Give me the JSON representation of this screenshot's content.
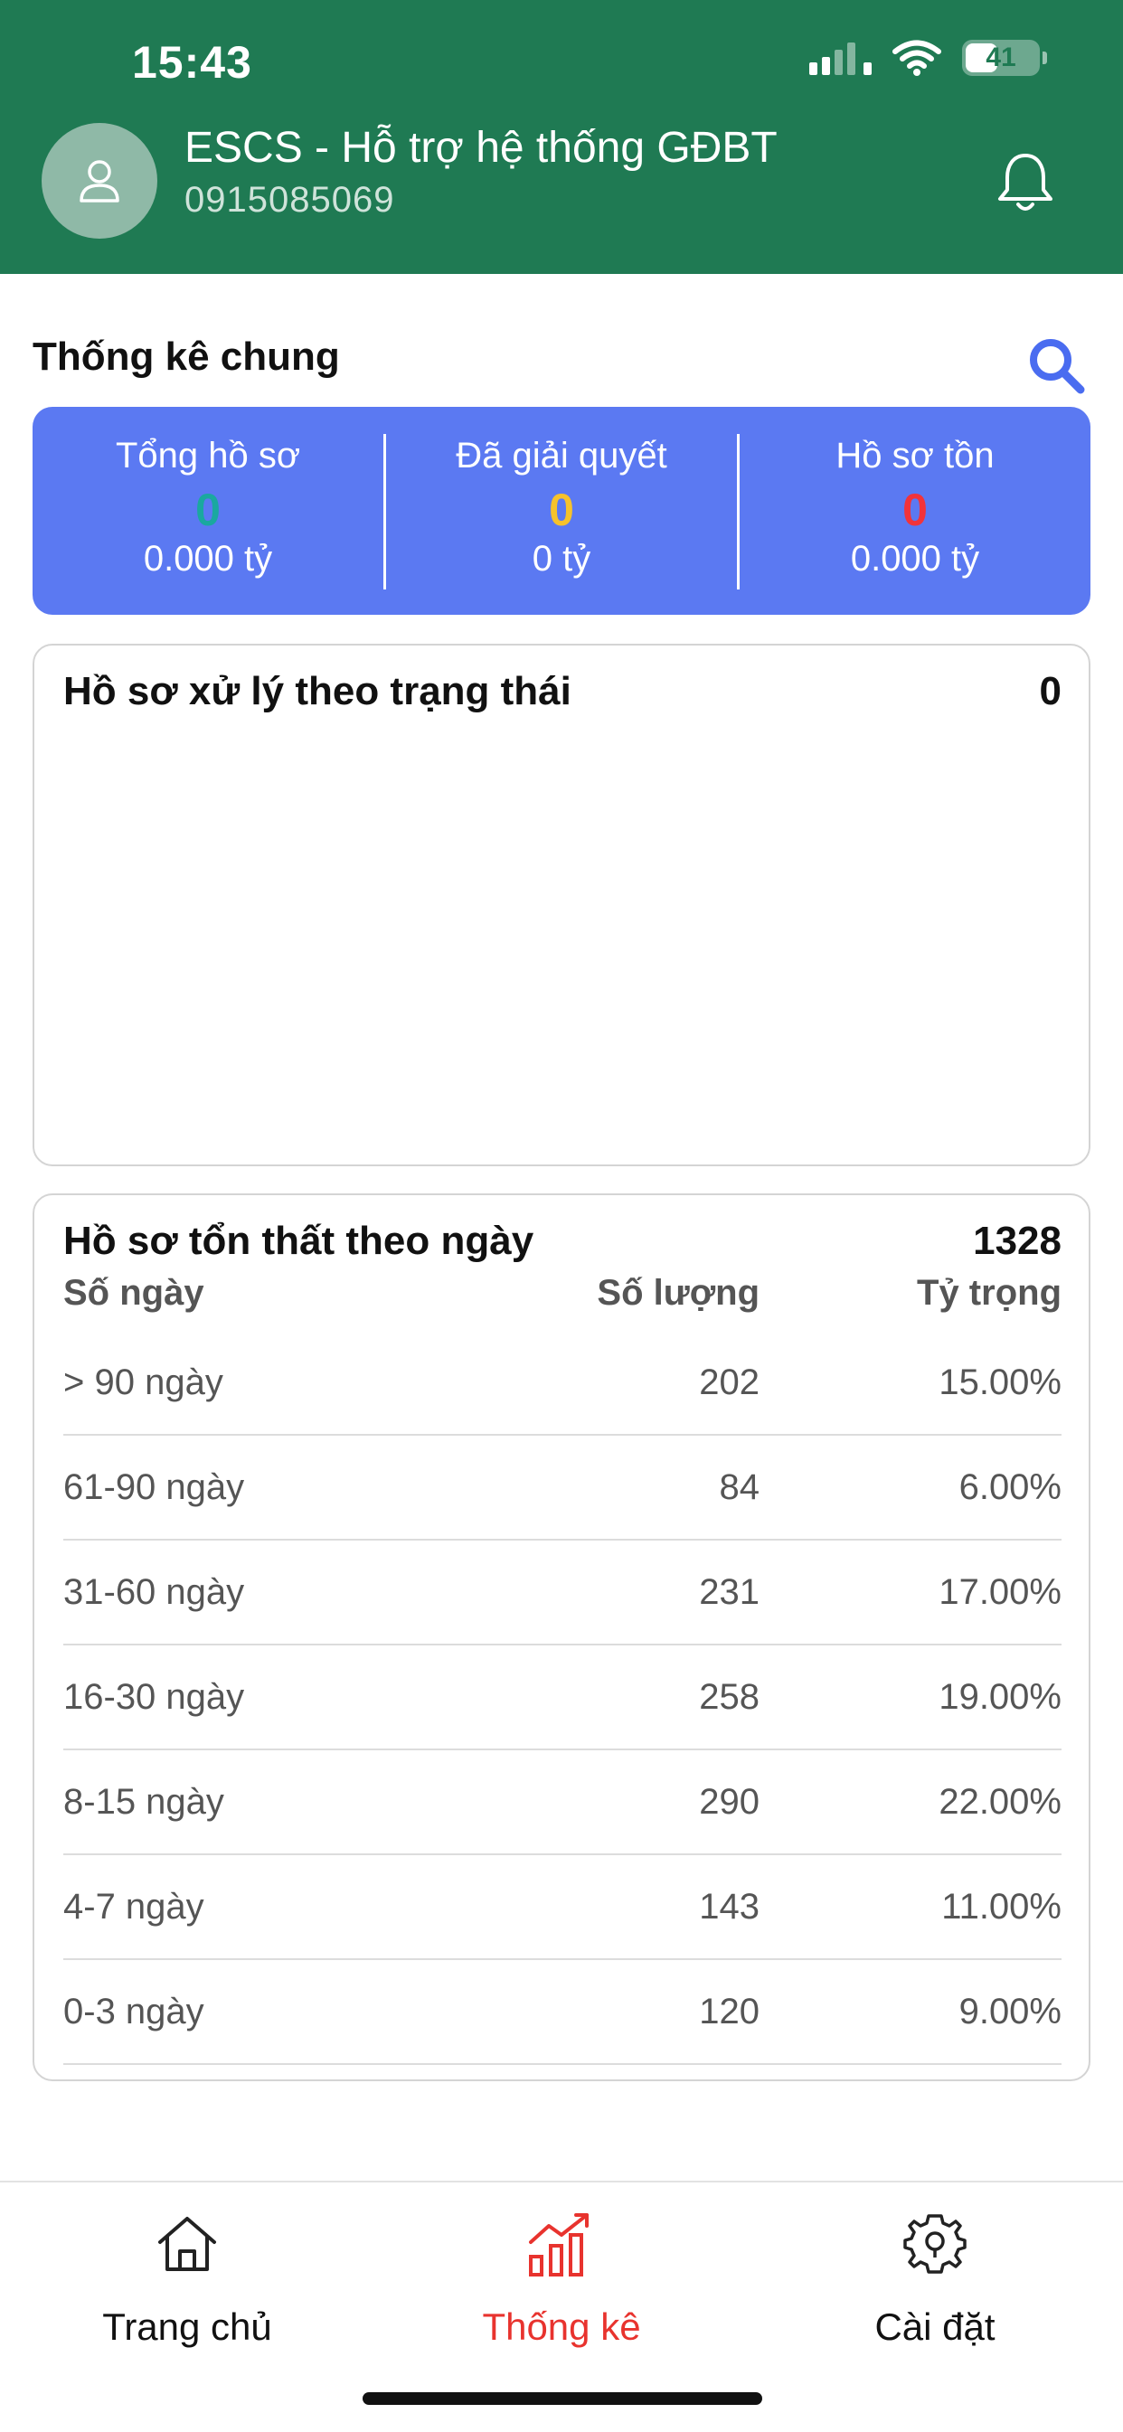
{
  "status_bar": {
    "time": "15:43",
    "battery": "41",
    "icons": [
      "cellular-signal-icon",
      "wifi-icon",
      "battery-icon"
    ]
  },
  "header": {
    "title": "ESCS - Hỗ trợ hệ thống GĐBT",
    "phone": "0915085069",
    "avatar_icon": "user-icon",
    "notification_icon": "bell-icon",
    "background_color": "#1f7a53"
  },
  "summary": {
    "title": "Thống kê chung",
    "search_icon": "search-icon",
    "card_color": "#5b79f2",
    "columns": [
      {
        "label": "Tổng hồ sơ",
        "count": "0",
        "amount": "0.000 tỷ",
        "count_color": "#1aa8a0"
      },
      {
        "label": "Đã giải quyết",
        "count": "0",
        "amount": "0 tỷ",
        "count_color": "#f6c22c"
      },
      {
        "label": "Hồ sơ tồn",
        "count": "0",
        "amount": "0.000 tỷ",
        "count_color": "#f2333a"
      }
    ]
  },
  "status_card": {
    "title": "Hồ sơ xử lý theo trạng thái",
    "total": "0"
  },
  "aging": {
    "title": "Hồ sơ tổn thất theo ngày",
    "total": "1328",
    "headers": [
      "Số ngày",
      "Số lượng",
      "Tỷ trọng"
    ],
    "rows": [
      {
        "range": "> 90 ngày",
        "count": "202",
        "ratio": "15.00%"
      },
      {
        "range": "61-90 ngày",
        "count": "84",
        "ratio": "6.00%"
      },
      {
        "range": "31-60 ngày",
        "count": "231",
        "ratio": "17.00%"
      },
      {
        "range": "16-30 ngày",
        "count": "258",
        "ratio": "19.00%"
      },
      {
        "range": "8-15 ngày",
        "count": "290",
        "ratio": "22.00%"
      },
      {
        "range": "4-7 ngày",
        "count": "143",
        "ratio": "11.00%"
      },
      {
        "range": "0-3 ngày",
        "count": "120",
        "ratio": "9.00%"
      }
    ]
  },
  "nav": {
    "items": [
      {
        "label": "Trang chủ",
        "icon": "home-icon",
        "active": false
      },
      {
        "label": "Thống kê",
        "icon": "chart-icon",
        "active": true
      },
      {
        "label": "Cài đặt",
        "icon": "gear-icon",
        "active": false
      }
    ],
    "active_color": "#e8332e"
  }
}
